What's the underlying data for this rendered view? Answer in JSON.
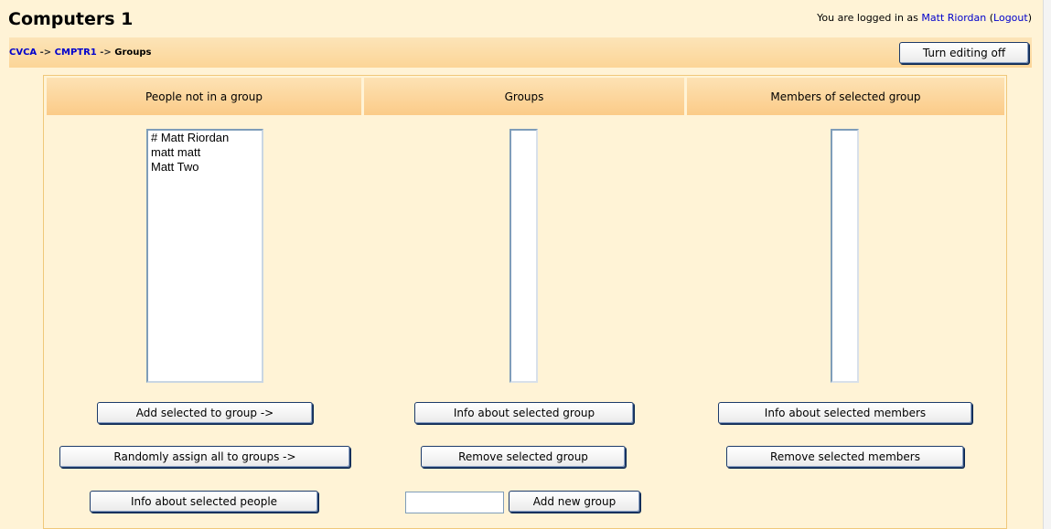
{
  "header": {
    "title": "Computers 1",
    "login_prefix": "You are logged in as",
    "user_name": "Matt Riordan",
    "logout_open": "(",
    "logout_label": "Logout",
    "logout_close": ")"
  },
  "breadcrumb": {
    "items": [
      "CVCA",
      "CMPTR1",
      "Groups"
    ],
    "separator": "->"
  },
  "toolbar": {
    "editing_label": "Turn editing off"
  },
  "columns": {
    "people_header": "People not in a group",
    "groups_header": "Groups",
    "members_header": "Members of selected group"
  },
  "people": [
    "# Matt Riordan",
    "matt matt",
    "Matt Two"
  ],
  "groups": [],
  "members": [],
  "buttons": {
    "add_to_group": "Add selected to group ->",
    "random_assign": "Randomly assign all to groups ->",
    "info_people": "Info about selected people",
    "info_group": "Info about selected group",
    "remove_group": "Remove selected group",
    "add_new_group": "Add new group",
    "info_members": "Info about selected members",
    "remove_members": "Remove selected members"
  },
  "new_group_input": {
    "value": ""
  },
  "colors": {
    "page_bg": "#fff3d6",
    "header_gradient_top": "#fde2b4",
    "header_gradient_bottom": "#fbcb88",
    "link": "#0000cc"
  }
}
